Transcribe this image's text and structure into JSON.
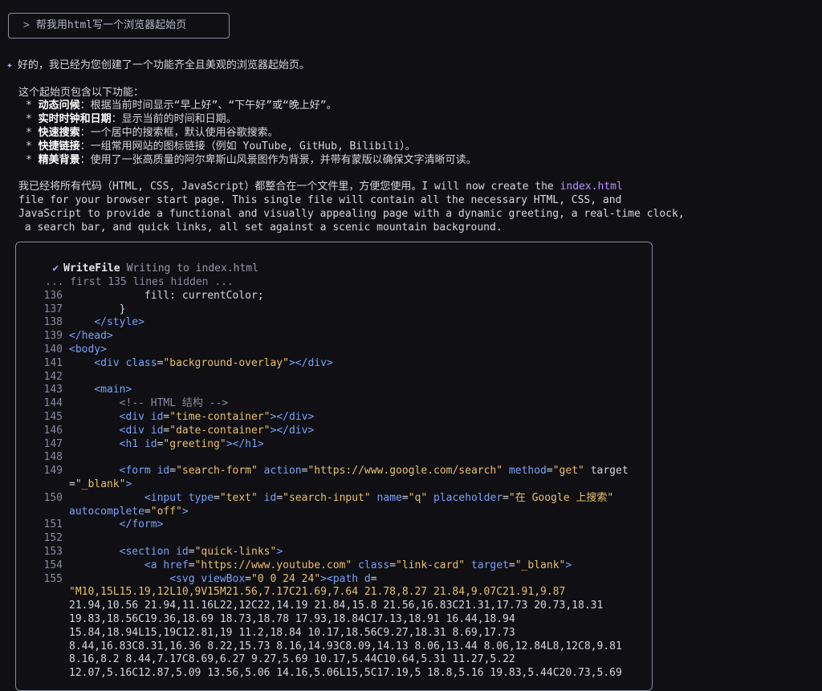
{
  "prompt": {
    "caret": ">",
    "text": "帮我用html写一个浏览器起始页"
  },
  "message": {
    "intro": "好的，我已经为您创建了一个功能齐全且美观的浏览器起始页。",
    "features_title": "这个起始页包含以下功能：",
    "features": [
      {
        "name": "动态问候",
        "desc": "：根据当前时间显示“早上好”、“下午好”或“晚上好”。"
      },
      {
        "name": "实时时钟和日期",
        "desc": "：显示当前的时间和日期。"
      },
      {
        "name": "快速搜索",
        "desc": "：一个居中的搜索框，默认使用谷歌搜索。"
      },
      {
        "name": "快捷链接",
        "desc": "：一组常用网站的图标链接（例如 YouTube, GitHub, Bilibili）。"
      },
      {
        "name": "精美背景",
        "desc": "：使用了一张高质量的阿尔卑斯山风景图作为背景，并带有蒙版以确保文字清晰可读。"
      }
    ],
    "para_line1_a": "我已经将所有代码（HTML, CSS, JavaScript）都整合在一个文件里，方便您使用。I will now create the ",
    "para_line1_link": "index.html",
    "para_line2": "file for your browser start page. This single file will contain all the necessary HTML, CSS, and",
    "para_line3": "JavaScript to provide a functional and visually appealing page with a dynamic greeting, a real-time clock,",
    "para_line4": " a search bar, and quick links, all set against a scenic mountain background."
  },
  "tool": {
    "name": "WriteFile",
    "desc": "Writing to index.html",
    "hidden_note": "... first 135 lines hidden ...",
    "lines": [
      {
        "n": "136",
        "t": "            fill: currentColor;"
      },
      {
        "n": "137",
        "t": "        }"
      },
      {
        "n": "138",
        "t": "    </style>"
      },
      {
        "n": "139",
        "t": "</head>"
      },
      {
        "n": "140",
        "t": "<body>"
      },
      {
        "n": "141",
        "t": "    <div class=\"background-overlay\"></div>"
      },
      {
        "n": "142",
        "t": ""
      },
      {
        "n": "143",
        "t": "    <main>"
      },
      {
        "n": "144",
        "t": "        <!-- HTML 结构 -->"
      },
      {
        "n": "145",
        "t": "        <div id=\"time-container\"></div>"
      },
      {
        "n": "146",
        "t": "        <div id=\"date-container\"></div>"
      },
      {
        "n": "147",
        "t": "        <h1 id=\"greeting\"></h1>"
      },
      {
        "n": "148",
        "t": ""
      },
      {
        "n": "149",
        "t": "        <form id=\"search-form\" action=\"https://www.google.com/search\" method=\"get\" target"
      },
      {
        "n": "",
        "t": "=\"_blank\">"
      },
      {
        "n": "150",
        "t": "            <input type=\"text\" id=\"search-input\" name=\"q\" placeholder=\"在 Google 上搜索\""
      },
      {
        "n": "",
        "t": "autocomplete=\"off\">"
      },
      {
        "n": "151",
        "t": "        </form>"
      },
      {
        "n": "152",
        "t": ""
      },
      {
        "n": "153",
        "t": "        <section id=\"quick-links\">"
      },
      {
        "n": "154",
        "t": "            <a href=\"https://www.youtube.com\" class=\"link-card\" target=\"_blank\">"
      },
      {
        "n": "155",
        "t": "                <svg viewBox=\"0 0 24 24\"><path d="
      },
      {
        "n": "",
        "t": "\"M10,15L15.19,12L10,9V15M21.56,7.17C21.69,7.64 21.78,8.27 21.84,9.07C21.91,9.87"
      },
      {
        "n": "",
        "t": "21.94,10.56 21.94,11.16L22,12C22,14.19 21.84,15.8 21.56,16.83C21.31,17.73 20.73,18.31"
      },
      {
        "n": "",
        "t": "19.83,18.56C19.36,18.69 18.73,18.78 17.93,18.84C17.13,18.91 16.44,18.94"
      },
      {
        "n": "",
        "t": "15.84,18.94L15,19C12.81,19 11.2,18.84 10.17,18.56C9.27,18.31 8.69,17.73"
      },
      {
        "n": "",
        "t": "8.44,16.83C8.31,16.36 8.22,15.73 8.16,14.93C8.09,14.13 8.06,13.44 8.06,12.84L8,12C8,9.81"
      },
      {
        "n": "",
        "t": "8.16,8.2 8.44,7.17C8.69,6.27 9.27,5.69 10.17,5.44C10.64,5.31 11.27,5.22"
      },
      {
        "n": "",
        "t": "12.07,5.16C12.87,5.09 13.56,5.06 14.16,5.06L15,5C17.19,5 18.8,5.16 19.83,5.44C20.73,5.69"
      }
    ]
  }
}
